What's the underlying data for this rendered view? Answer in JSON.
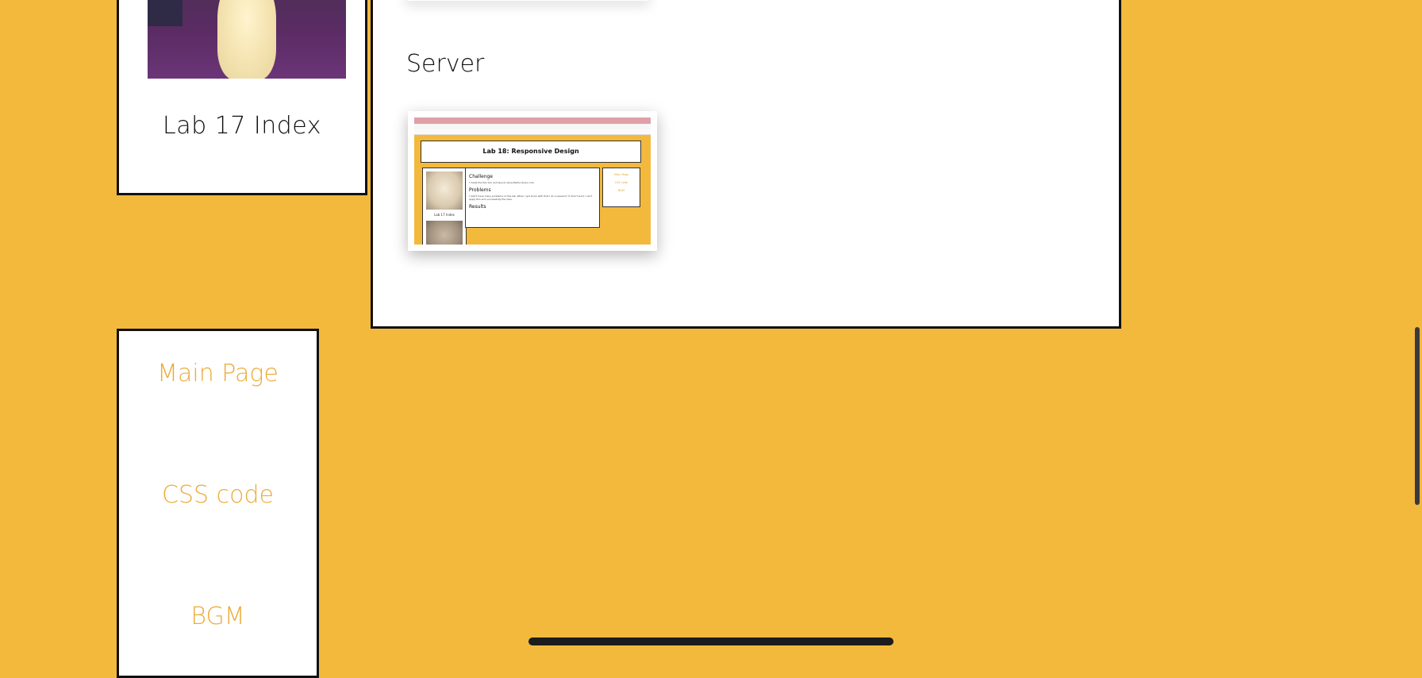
{
  "side_card": {
    "title": "Lab 17 Index"
  },
  "main_card": {
    "section_title": "Server",
    "screenshot": {
      "header_title": "Lab 18: Responsive Design",
      "side_label": "Lab 17 Index",
      "headings": [
        "Challenge",
        "Problems",
        "Results"
      ],
      "challenge_text": "I made the flex box and layout using Media Query rule",
      "problems_text": "I didn't have many problems in this lab. When I got stuck with that I do a research. It didn't work I can't apply this and successfully the idea.",
      "nav_items": [
        "Main Page",
        "CSS code",
        "BGM"
      ]
    }
  },
  "nav": {
    "items": [
      "Main Page",
      "CSS code",
      "BGM"
    ]
  },
  "colors": {
    "background": "#f3b93d",
    "link": "#ecab3a",
    "border": "#111111"
  },
  "icons": {
    "scrollbar": "scrollbar-thumb",
    "home_indicator": "home-indicator-bar"
  }
}
